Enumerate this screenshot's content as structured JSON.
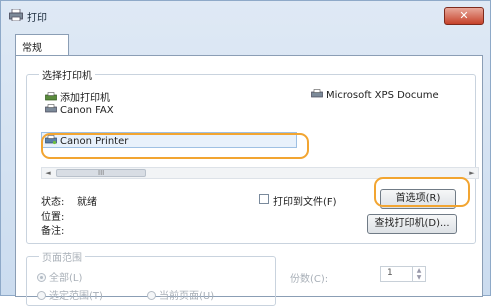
{
  "window": {
    "title": "打印",
    "close_symbol": "✕"
  },
  "tabs": [
    {
      "label": "常规"
    }
  ],
  "select_printer": {
    "label": "选择打印机",
    "printers": [
      {
        "name": "添加打印机"
      },
      {
        "name": "Canon FAX"
      },
      {
        "name": "Canon Printer"
      },
      {
        "name": "Microsoft XPS Docume"
      }
    ],
    "selected_printer": "Canon Printer",
    "scroll_grip": "III",
    "scroll_left_symbol": "◄",
    "scroll_right_symbol": "►"
  },
  "status_info": {
    "status_label": "状态:",
    "status_value": "就绪",
    "location_label": "位置:",
    "comment_label": "备注:"
  },
  "print_to_file_label": "打印到文件(F)",
  "preferences_button": "首选项(R)",
  "find_printer_button": "查找打印机(D)...",
  "page_range": {
    "label": "页面范围",
    "all_label": "全部(L)",
    "selection_label": "选定范围(T)",
    "current_page_label": "当前页面(U)"
  },
  "copies": {
    "label": "份数(C):",
    "value": "1"
  },
  "colors": {
    "highlight": "#f2a531",
    "selection": "#e8f1fb"
  }
}
